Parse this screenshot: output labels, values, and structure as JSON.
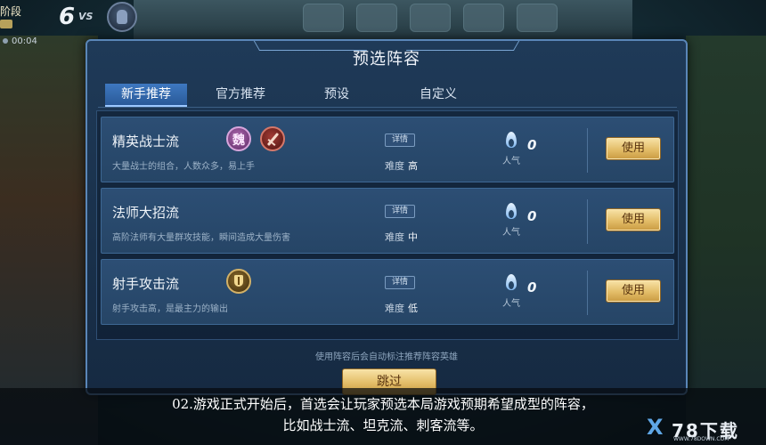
{
  "hud": {
    "stage_label": "阶段",
    "score": "6",
    "vs": "VS",
    "timer": "00:04"
  },
  "dialog": {
    "title": "预选阵容",
    "tabs": [
      {
        "label": "新手推荐",
        "active": true
      },
      {
        "label": "官方推荐",
        "active": false
      },
      {
        "label": "预设",
        "active": false
      },
      {
        "label": "自定义",
        "active": false
      }
    ],
    "detail_label": "详情",
    "difficulty_label": "难度",
    "popularity_label": "人气",
    "use_label": "使用",
    "lineups": [
      {
        "name": "精英战士流",
        "desc": "大量战士的组合，人数众多，易上手",
        "difficulty": "高",
        "popularity": "0",
        "hero_icons": [
          "wei-faction-icon",
          "sword-icon"
        ],
        "hero_glyph": "魏"
      },
      {
        "name": "法师大招流",
        "desc": "高阶法师有大量群攻技能，瞬间造成大量伤害",
        "difficulty": "中",
        "popularity": "0",
        "hero_icons": []
      },
      {
        "name": "射手攻击流",
        "desc": "射手攻击高，是最主力的输出",
        "difficulty": "低",
        "popularity": "0",
        "hero_icons": [
          "shield-icon"
        ]
      }
    ],
    "note": "使用阵容后会自动标注推荐阵容英雄",
    "skip_label": "跳过"
  },
  "caption": {
    "line1": "02.游戏正式开始后，首选会让玩家预选本局游戏预期希望成型的阵容，",
    "line2": "比如战士流、坦克流、刺客流等。"
  },
  "watermark": {
    "text": "78下载",
    "sub": "WWW.78DOWN.COM"
  },
  "colors": {
    "dialog_border": "#5a86b8",
    "tab_active": "#3e78c0",
    "gold_button": "#e3bd68"
  }
}
